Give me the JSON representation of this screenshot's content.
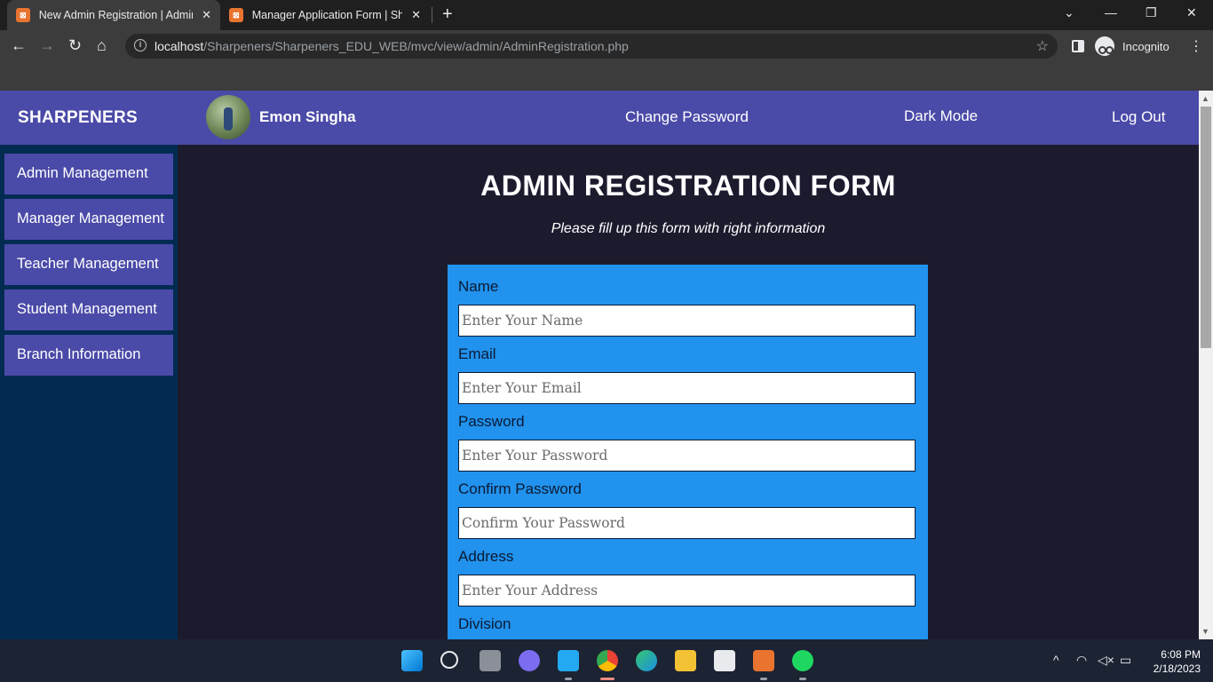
{
  "browser": {
    "tabs": [
      {
        "title": "New Admin Registration | Admin",
        "active": true
      },
      {
        "title": "Manager Application Form | Shar",
        "active": false
      }
    ],
    "url_host": "localhost",
    "url_path": "/Sharpeners/Sharpeners_EDU_WEB/mvc/view/admin/AdminRegistration.php",
    "profile_label": "Incognito"
  },
  "header": {
    "brand": "SHARPENERS",
    "user_name": "Emon Singha",
    "links": [
      "Change Password",
      "Dark Mode",
      "Log Out"
    ]
  },
  "sidebar": {
    "items": [
      {
        "label": "Admin Management"
      },
      {
        "label": "Manager Management"
      },
      {
        "label": "Teacher Management"
      },
      {
        "label": "Student Management"
      },
      {
        "label": "Branch Information"
      }
    ]
  },
  "form": {
    "title": "ADMIN REGISTRATION FORM",
    "subtitle": "Please fill up this form with right information",
    "fields": [
      {
        "label": "Name",
        "placeholder": "Enter Your Name"
      },
      {
        "label": "Email",
        "placeholder": "Enter Your Email"
      },
      {
        "label": "Password",
        "placeholder": "Enter Your Password"
      },
      {
        "label": "Confirm Password",
        "placeholder": "Confirm Your Password"
      },
      {
        "label": "Address",
        "placeholder": "Enter Your Address"
      },
      {
        "label": "Division"
      }
    ]
  },
  "taskbar": {
    "time": "6:08 PM",
    "date": "2/18/2023",
    "apps": [
      "windows-start",
      "search",
      "task-view",
      "chat",
      "vscode",
      "chrome",
      "edge",
      "file-explorer",
      "store",
      "xampp",
      "spotify"
    ]
  },
  "colors": {
    "header_bg": "#4a4aa8",
    "sidebar_bg": "#022b52",
    "page_bg": "#1c1b2e",
    "form_bg": "#2192ed"
  }
}
